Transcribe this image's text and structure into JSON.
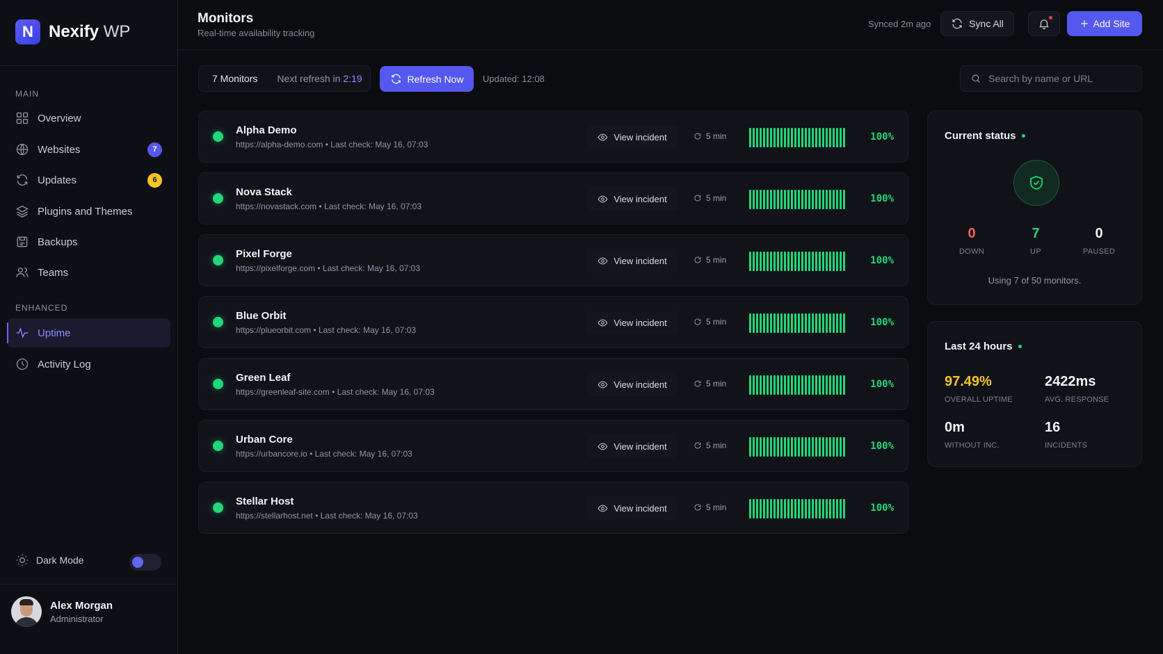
{
  "brand": {
    "initial": "N",
    "name": "Nexify",
    "suffix": "WP"
  },
  "sidebar": {
    "main_label": "MAIN",
    "enhanced_label": "ENHANCED",
    "items": [
      {
        "label": "Overview",
        "icon": "grid-icon"
      },
      {
        "label": "Websites",
        "icon": "globe-icon",
        "badge": "7"
      },
      {
        "label": "Updates",
        "icon": "refresh-icon",
        "badge": "6"
      },
      {
        "label": "Plugins and Themes",
        "icon": "layers-icon"
      },
      {
        "label": "Backups",
        "icon": "backup-icon"
      },
      {
        "label": "Teams",
        "icon": "users-icon"
      },
      {
        "label": "Uptime",
        "icon": "pulse-icon",
        "active": true
      },
      {
        "label": "Activity Log",
        "icon": "clock-icon"
      }
    ],
    "dark_mode_label": "Dark Mode",
    "dark_mode_on": true,
    "user": {
      "name": "Alex Morgan",
      "role": "Administrator"
    }
  },
  "header": {
    "title": "Monitors",
    "subtitle": "Real-time availability tracking",
    "synced": "Synced 2m ago",
    "sync_all": "Sync All",
    "add_site": "Add Site"
  },
  "toolbar": {
    "monitor_count": "7 Monitors",
    "next_refresh_label": "Next refresh in",
    "next_refresh_time": "2:19",
    "refresh_now": "Refresh Now",
    "updated": "Updated: 12:08",
    "search_placeholder": "Search by name or URL"
  },
  "monitors": [
    {
      "name": "Alpha Demo",
      "url": "https://alpha-demo.com",
      "last_check": "Last check: May 16, 07:03",
      "action": "View incident",
      "interval": "5 min",
      "uptime": "100%"
    },
    {
      "name": "Nova Stack",
      "url": "https://novastack.com",
      "last_check": "Last check: May 16, 07:03",
      "action": "View incident",
      "interval": "5 min",
      "uptime": "100%"
    },
    {
      "name": "Pixel Forge",
      "url": "https://pixelforge.com",
      "last_check": "Last check: May 16, 07:03",
      "action": "View incident",
      "interval": "5 min",
      "uptime": "100%"
    },
    {
      "name": "Blue Orbit",
      "url": "https://plueorbit.com",
      "last_check": "Last check: May 16, 07:03",
      "action": "View incident",
      "interval": "5 min",
      "uptime": "100%"
    },
    {
      "name": "Green Leaf",
      "url": "https://greenleaf-site.com",
      "last_check": "Last check: May 16, 07:03",
      "action": "View incident",
      "interval": "5 min",
      "uptime": "100%"
    },
    {
      "name": "Urban Core",
      "url": "https://urbancore.io",
      "last_check": "Last check: May 16, 07:03",
      "action": "View incident",
      "interval": "5 min",
      "uptime": "100%"
    },
    {
      "name": "Stellar Host",
      "url": "https://stellarhost.net",
      "last_check": "Last check: May 16, 07:03",
      "action": "View incident",
      "interval": "5 min",
      "uptime": "100%"
    }
  ],
  "current_status": {
    "title": "Current status",
    "down": {
      "value": "0",
      "label": "DOWN"
    },
    "up": {
      "value": "7",
      "label": "UP"
    },
    "paused": {
      "value": "0",
      "label": "PAUSED"
    },
    "usage": "Using 7 of 50 monitors."
  },
  "last_24h": {
    "title": "Last 24 hours",
    "overall_uptime": {
      "value": "97.49%",
      "label": "OVERALL UPTIME"
    },
    "avg_response": {
      "value": "2422ms",
      "label": "AVG. RESPONSE"
    },
    "without_inc": {
      "value": "0m",
      "label": "WITHOUT INC."
    },
    "incidents": {
      "value": "16",
      "label": "INCIDENTS"
    }
  },
  "colors": {
    "accent": "#5558ee",
    "up": "#22d67a",
    "down": "#f0625a",
    "warning": "#f5c524"
  }
}
